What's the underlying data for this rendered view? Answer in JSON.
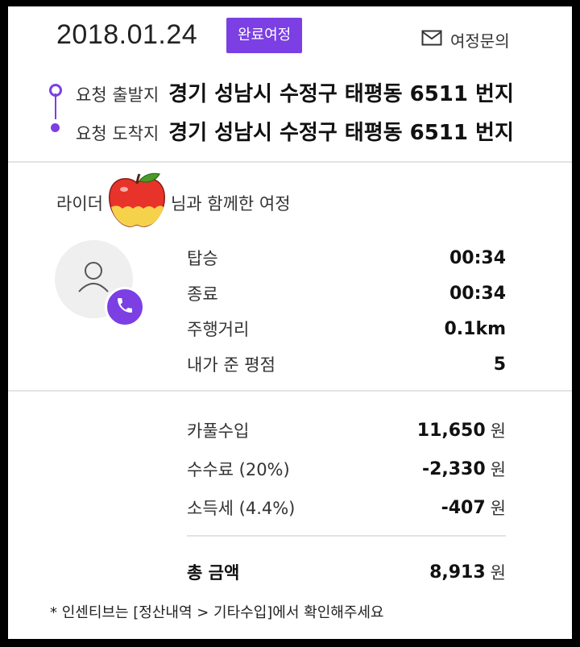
{
  "header": {
    "date": "2018.01.24",
    "badge": "완료여정",
    "inquiry_label": "여정문의"
  },
  "route": {
    "origin_label": "요청 출발지",
    "origin_address": "경기 성남시 수정구 태평동 6511 번지",
    "destination_label": "요청 도착지",
    "destination_address": "경기 성남시 수정구 태평동 6511 번지"
  },
  "rider": {
    "prefix": "라이더",
    "suffix": "님과 함께한 여정"
  },
  "stats": [
    {
      "label": "탑승",
      "value": "00:34"
    },
    {
      "label": "종료",
      "value": "00:34"
    },
    {
      "label": "주행거리",
      "value": "0.1km"
    },
    {
      "label": "내가 준 평점",
      "value": "5"
    }
  ],
  "income": [
    {
      "label": "카풀수입",
      "value": "11,650",
      "unit": "원"
    },
    {
      "label": "수수료 (20%)",
      "value": "-2,330",
      "unit": "원"
    },
    {
      "label": "소득세 (4.4%)",
      "value": "-407",
      "unit": "원"
    }
  ],
  "total": {
    "label": "총 금액",
    "value": "8,913",
    "unit": "원"
  },
  "footnote": "* 인센티브는 [정산내역 > 기타수입]에서 확인해주세요",
  "colors": {
    "accent": "#7b3fe4",
    "divider": "#e3e3e3"
  },
  "icons": [
    "mail-icon",
    "user-icon",
    "phone-icon",
    "apple-icon"
  ]
}
